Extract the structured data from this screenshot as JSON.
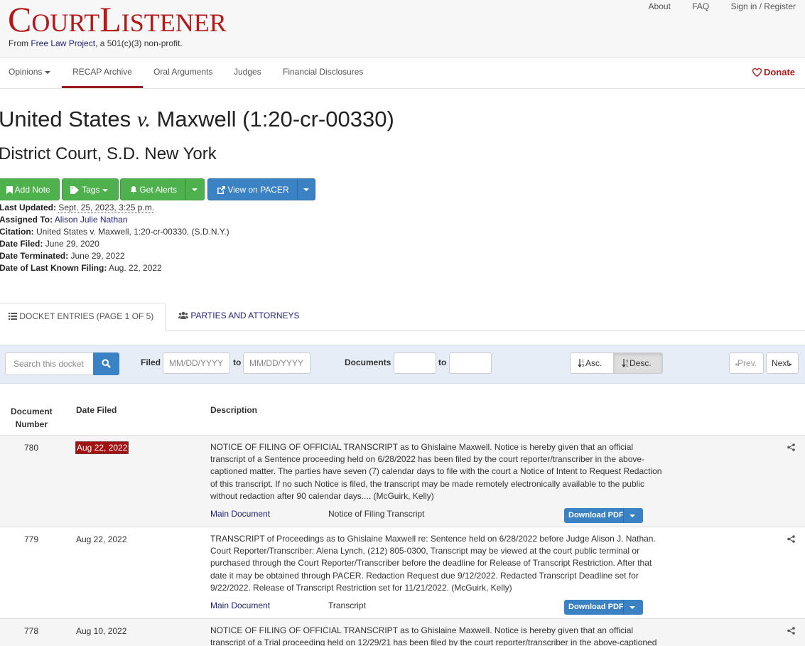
{
  "header": {
    "logo_part1_initial": "C",
    "logo_part1_rest": "OURT",
    "logo_part2_initial": "L",
    "logo_part2_rest": "ISTENER",
    "tagline_prefix": "From ",
    "tagline_link": "Free Law Project",
    "tagline_suffix": ", a 501(c)(3) non-profit.",
    "links": [
      "About",
      "FAQ",
      "Sign in / Register"
    ]
  },
  "nav": {
    "items": [
      "Opinions",
      "RECAP Archive",
      "Oral Arguments",
      "Judges",
      "Financial Disclosures"
    ],
    "active": "RECAP Archive",
    "donate": "Donate"
  },
  "case": {
    "title_left": "United States ",
    "title_v": "v.",
    "title_right": " Maxwell (1:20-cr-00330)",
    "court": "District Court, S.D. New York"
  },
  "actions": {
    "add_note": "Add Note",
    "tags": "Tags",
    "get_alerts": "Get Alerts",
    "view_pacer": "View on PACER"
  },
  "meta": {
    "last_updated_label": "Last Updated:",
    "last_updated": "Sept. 25, 2023, 3:25 p.m.",
    "assigned_label": "Assigned To:",
    "assigned": "Alison Julie Nathan",
    "citation_label": "Citation:",
    "citation": "United States v. Maxwell, 1:20-cr-00330, (S.D.N.Y.)",
    "filed_label": "Date Filed:",
    "filed": "June 29, 2020",
    "terminated_label": "Date Terminated:",
    "terminated": "June 29, 2022",
    "last_filing_label": "Date of Last Known Filing:",
    "last_filing": "Aug. 22, 2022"
  },
  "tabs": {
    "docket": "DOCKET ENTRIES (PAGE 1 OF 5)",
    "parties": "PARTIES AND ATTORNEYS"
  },
  "filters": {
    "search_placeholder": "Search this docket",
    "filed_label": "Filed",
    "date_placeholder": "MM/DD/YYYY",
    "to": "to",
    "documents_label": "Documents",
    "asc": "Asc.",
    "desc": "Desc.",
    "sort_selected": "Desc.",
    "prev": "Prev.",
    "next": "Next"
  },
  "table": {
    "headers": {
      "doc_num_1": "Document",
      "doc_num_2": "Number",
      "date": "Date Filed",
      "desc": "Description"
    },
    "rows": [
      {
        "number": "780",
        "date": "Aug 22, 2022",
        "description": "NOTICE OF FILING OF OFFICIAL TRANSCRIPT as to Ghislaine Maxwell. Notice is hereby given that an official transcript of a Sentence proceeding held on 6/28/2022 has been filed by the court reporter/transcriber in the above-captioned matter. The parties have seven (7) calendar days to file with the court a Notice of Intent to Request Redaction of this transcript. If no such Notice is filed, the transcript may be made remotely electronically available to the public without redaction after 90 calendar days.... (McGuirk, Kelly)",
        "doc_link": "Main Document",
        "doc_desc": "Notice of Filing Transcript",
        "download": "Download PDF"
      },
      {
        "number": "779",
        "date": "Aug 22, 2022",
        "description": "TRANSCRIPT of Proceedings as to Ghislaine Maxwell re: Sentence held on 6/28/2022 before Judge Alison J. Nathan. Court Reporter/Transcriber: Alena Lynch, (212) 805-0300, Transcript may be viewed at the court public terminal or purchased through the Court Reporter/Transcriber before the deadline for Release of Transcript Restriction. After that date it may be obtained through PACER. Redaction Request due 9/12/2022. Redacted Transcript Deadline set for 9/22/2022. Release of Transcript Restriction set for 11/21/2022. (McGuirk, Kelly)",
        "doc_link": "Main Document",
        "doc_desc": "Transcript",
        "download": "Download PDF"
      },
      {
        "number": "778",
        "date": "Aug 10, 2022",
        "description": "NOTICE OF FILING OF OFFICIAL TRANSCRIPT as to Ghislaine Maxwell. Notice is hereby given that an official transcript of a Trial proceeding held on 12/29/21 has been filed by the court reporter/transcriber in the above-captioned"
      }
    ]
  },
  "colors": {
    "brand_red": "#b21a1a",
    "link_blue": "#23237a",
    "button_green": "#4eb14e",
    "button_blue": "#3a82c4",
    "filter_bg": "#e6edf7"
  }
}
